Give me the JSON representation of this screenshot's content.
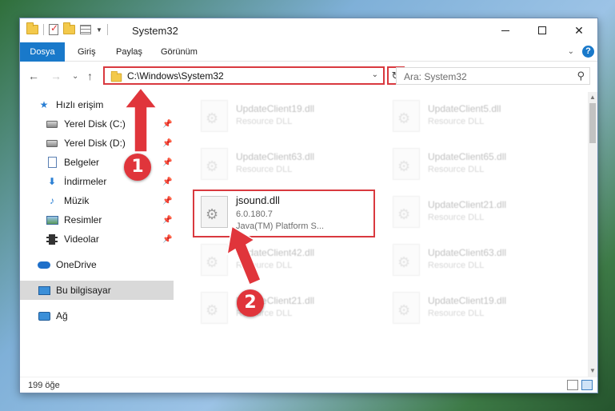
{
  "window": {
    "title": "System32",
    "controls": {
      "minimize": "—",
      "maximize": "☐",
      "close": "✕"
    }
  },
  "ribbon": {
    "tabs": [
      {
        "label": "Dosya"
      },
      {
        "label": "Giriş"
      },
      {
        "label": "Paylaş"
      },
      {
        "label": "Görünüm"
      }
    ],
    "collapse": "⌄",
    "help": "?"
  },
  "navigation": {
    "back": "←",
    "forward": "→",
    "recent": "⌄",
    "up": "↑",
    "address": "C:\\Windows\\System32",
    "address_dropdown": "⌄",
    "refresh": "↻",
    "search_placeholder": "Ara: System32",
    "search_icon": "⚲"
  },
  "sidebar": {
    "items": [
      {
        "label": "Hızlı erişim",
        "icon": "star-icon"
      },
      {
        "label": "Yerel Disk (C:)",
        "icon": "disk-icon",
        "pinned": true
      },
      {
        "label": "Yerel Disk (D:)",
        "icon": "disk-icon",
        "pinned": true
      },
      {
        "label": "Belgeler",
        "icon": "document-icon",
        "pinned": true
      },
      {
        "label": "İndirmeler",
        "icon": "download-icon",
        "pinned": true
      },
      {
        "label": "Müzik",
        "icon": "music-icon",
        "pinned": true
      },
      {
        "label": "Resimler",
        "icon": "pictures-icon",
        "pinned": true
      },
      {
        "label": "Videolar",
        "icon": "video-icon",
        "pinned": true
      },
      {
        "label": "OneDrive",
        "icon": "onedrive-icon"
      },
      {
        "label": "Bu bilgisayar",
        "icon": "computer-icon",
        "selected": true
      },
      {
        "label": "Ağ",
        "icon": "network-icon"
      }
    ],
    "pin_glyph": "📌"
  },
  "files": {
    "items": [
      {
        "name": "UpdateClient19.dll",
        "type": "Resource DLL"
      },
      {
        "name": "UpdateClient5.dll",
        "type": "Resource DLL"
      },
      {
        "name": "UpdateClient63.dll",
        "type": "Resource DLL"
      },
      {
        "name": "UpdateClient65.dll",
        "type": "Resource DLL"
      },
      {
        "name": "UpdateClient21.dll",
        "type": "Resource DLL"
      },
      {
        "name": "UpdateClient42.dll",
        "type": "Resource DLL"
      },
      {
        "name": "UpdateClient63.dll",
        "type": "Resource DLL"
      },
      {
        "name": "UpdateClient21.dll",
        "type": "Resource DLL"
      },
      {
        "name": "UpdateClient19.dll",
        "type": "Resource DLL"
      }
    ],
    "focused": {
      "name": "jsound.dll",
      "version": "6.0.180.7",
      "description": "Java(TM) Platform S..."
    }
  },
  "status": {
    "count": "199 öğe"
  },
  "annotations": {
    "step1": "1",
    "step2": "2",
    "color": "#e0353b"
  }
}
